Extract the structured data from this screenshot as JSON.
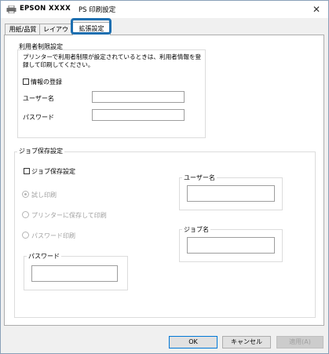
{
  "window": {
    "brand": "EPSON",
    "model": "XXXX",
    "title": "PS 印刷設定",
    "close_glyph": "✕"
  },
  "tabs": [
    {
      "label": "用紙/品質"
    },
    {
      "label": "レイアウ"
    },
    {
      "label": "拡張設定"
    }
  ],
  "user_limit": {
    "title": "利用者制限設定",
    "description_line1": "プリンターで利用者制限が設定されているときは、利用者情報を登",
    "description_line2": "録して印刷してください。",
    "register_label": "情報の登録",
    "username_label": "ユーザー名",
    "username_value": "",
    "password_label": "パスワード",
    "password_value": ""
  },
  "job_storage": {
    "title": "ジョブ保存設定",
    "enable_label": "ジョブ保存設定",
    "options": [
      {
        "label": "試し印刷",
        "selected": true
      },
      {
        "label": "プリンターに保存して印刷",
        "selected": false
      },
      {
        "label": "パスワード印刷",
        "selected": false
      }
    ],
    "password_group_title": "パスワード",
    "password_value": "",
    "username_group_title": "ユーザー名",
    "username_value": "",
    "jobname_group_title": "ジョブ名",
    "jobname_value": ""
  },
  "footer": {
    "ok": "OK",
    "cancel": "キャンセル",
    "apply": "適用(A)"
  },
  "colors": {
    "tab_highlight": "#1e6fb0",
    "primary_button_border": "#0078d7"
  }
}
